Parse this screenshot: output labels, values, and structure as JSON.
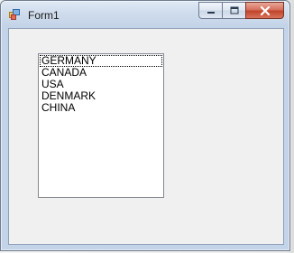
{
  "window": {
    "title": "Form1",
    "icon": "winforms-app-icon",
    "caption_buttons": [
      "minimize-icon",
      "maximize-icon",
      "close-icon"
    ]
  },
  "listbox": {
    "items": [
      {
        "label": "GERMANY",
        "focused": true
      },
      {
        "label": "CANADA",
        "focused": false
      },
      {
        "label": "USA",
        "focused": false
      },
      {
        "label": "DENMARK",
        "focused": false
      },
      {
        "label": "CHINA",
        "focused": false
      }
    ]
  },
  "colors": {
    "client_background": "#f0f0f0",
    "close_button": "#c2442c",
    "listbox_border": "#828790"
  }
}
